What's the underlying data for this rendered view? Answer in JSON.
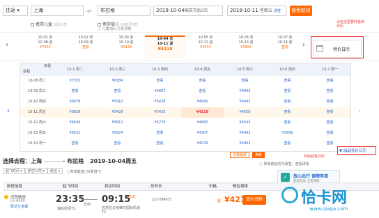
{
  "search": {
    "trip_type": "往返",
    "from": "上海",
    "swap": "⇄",
    "to": "布拉格",
    "depart": "2019-10-04",
    "depart_note": "国庆节后3天",
    "return": "2019-10-11",
    "return_note": "星期五",
    "return_suffix": "改签",
    "button": "搜索航班",
    "child": "携带儿童",
    "child_hint": "2至12岁",
    "infant": "携带婴儿",
    "infant_hint": "14天至2岁",
    "notice": "儿童/婴儿订票须知"
  },
  "datestrip": [
    {
      "d1": "10-01 去",
      "d2": "10-08 返",
      "price": "¥7552"
    },
    {
      "d1": "10-02 去",
      "d2": "10-09 返",
      "price": "查看"
    },
    {
      "d1": "10-03 去",
      "d2": "10-10 返",
      "price": "¥5428"
    },
    {
      "d1": "10-04 去",
      "d2": "10-11 返",
      "price": "¥4218"
    },
    {
      "d1": "10-05 去",
      "d2": "10-12 返",
      "price": "¥4553"
    },
    {
      "d1": "10-06 去",
      "d2": "10-13 返",
      "price": "¥3999"
    },
    {
      "d1": "10-07 去",
      "d2": "10-14 返",
      "price": "查看"
    }
  ],
  "calendar_button": "特价日历",
  "annotation_top": "点击这里要并看到日历",
  "matrix": {
    "corner_top": "去程",
    "corner_bottom": "返程",
    "cols": [
      "10-1 周二",
      "10-2 周三",
      "10-3 周四",
      "10-4 周五",
      "10-5 周六",
      "10-6 周日",
      "10-7 周一"
    ],
    "rows": [
      {
        "label": "10-08 周二",
        "cells": [
          "¥7552",
          "¥6184",
          "查看",
          "查看",
          "查看",
          "查看",
          "查看"
        ]
      },
      {
        "label": "10-09 周三",
        "cells": [
          "查看",
          "查看",
          "¥5667",
          "查看",
          "¥4843",
          "查看",
          "查看"
        ]
      },
      {
        "label": "10-10 周四",
        "cells": [
          "¥6878",
          "¥5910",
          "¥5428",
          "¥4940",
          "¥4843",
          "查看",
          "查看"
        ]
      },
      {
        "label": "10-11 周五",
        "cells": [
          "¥6829",
          "¥5429",
          "¥5425",
          "¥4218",
          "¥4558",
          "查看",
          "查看"
        ]
      },
      {
        "label": "10-12 周六",
        "cells": [
          "¥6636",
          "¥5812",
          "¥5279",
          "¥4660",
          "¥4543",
          "查看",
          "查看"
        ]
      },
      {
        "label": "10-13 周日",
        "cells": [
          "¥6552",
          "¥5924",
          "查看",
          "¥4307",
          "¥4063",
          "¥3999",
          "查看"
        ]
      },
      {
        "label": "10-14 周一",
        "cells": [
          "查看",
          "查看",
          "查看",
          "¥4079",
          "¥4063",
          "查看",
          "查看"
        ]
      }
    ]
  },
  "annotation_bottom": "问收起看日历",
  "collapse_button": "▼ 收起低价日历",
  "route": {
    "prefix": "选择去程：上海",
    "arrow": "———→",
    "to": "布拉格",
    "date": "2019-10-04周五"
  },
  "filters": [
    "起飞时间",
    "航空公司",
    "舱位",
    "共享航班"
  ],
  "filter_extra": "只看直飞",
  "sort": [
    "价格最低",
    "推荐"
  ],
  "notice": "所有航班均可改签，查看详情",
  "promo": {
    "title": "放心出行 保障有我",
    "sub": "航班延误 全程保障"
  },
  "thead": [
    "航班信息",
    "起飞时间",
    "到达时间",
    "总时长",
    "价格",
    "舱位排序"
  ],
  "flight": {
    "airline": "汉莎航空",
    "flight_no": "LH 8400",
    "transfer": "经法兰克福",
    "dep_time": "23:35",
    "dep_airport": "浦东机场T2",
    "arr_time": "09:15",
    "arr_day": "+1天",
    "arr_airport": "瓦茨拉夫哈维尔国际机场T2",
    "duration": "15小时40分",
    "stop": "经停",
    "price": "¥4218",
    "price_note": "起",
    "button": "选为去程"
  },
  "watermark": {
    "main": "恰卡网",
    "sub": "www.qiaqa.com"
  },
  "colors": {
    "accent": "#ff6600",
    "link": "#2266c8",
    "highlight": "#e33333"
  }
}
